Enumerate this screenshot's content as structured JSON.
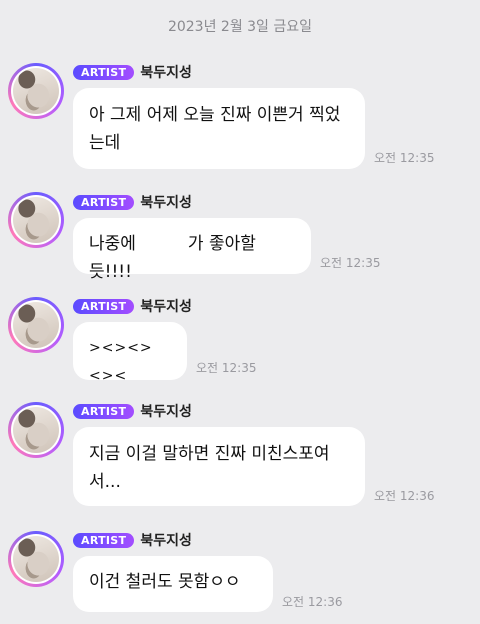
{
  "date_separator": "2023년 2월 3일 금요일",
  "messages": [
    {
      "badge": "ARTIST",
      "name": "북두지성",
      "text": "아 그제 어제 오늘 진짜 이쁜거 찍었는데",
      "time": "오전 12:35"
    },
    {
      "badge": "ARTIST",
      "name": "북두지성",
      "text_before": "나중에",
      "text_after": "가 좋아할듯!!!!",
      "time": "오전 12:35"
    },
    {
      "badge": "ARTIST",
      "name": "북두지성",
      "text": "><><><><",
      "time": "오전 12:35"
    },
    {
      "badge": "ARTIST",
      "name": "북두지성",
      "text": "지금 이걸 말하면 진짜 미친스포여서...",
      "time": "오전 12:36"
    },
    {
      "badge": "ARTIST",
      "name": "북두지성",
      "text": "이건 철러도 못함ㅇㅇ",
      "time": "오전 12:36"
    }
  ]
}
